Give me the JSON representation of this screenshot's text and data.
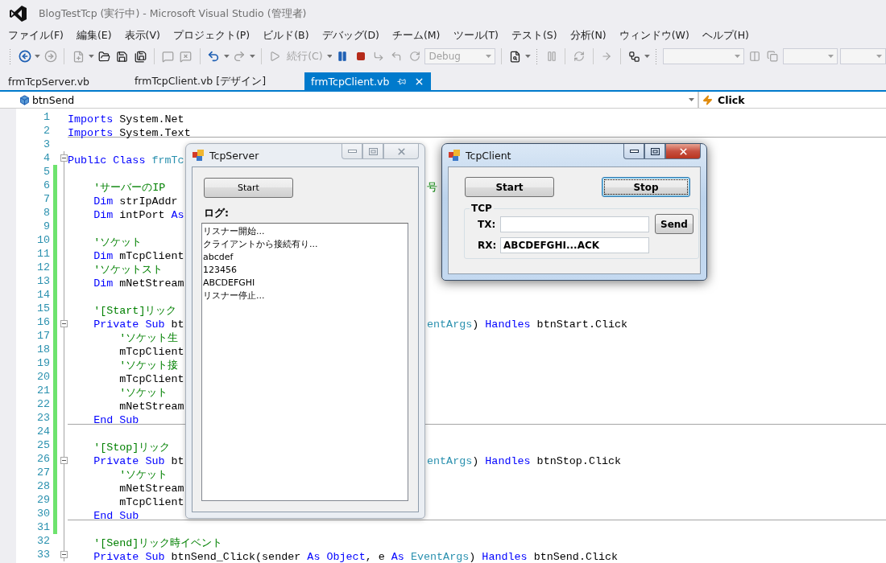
{
  "window": {
    "title": "BlogTestTcp (実行中) - Microsoft Visual Studio (管理者)"
  },
  "menu": [
    "ファイル(F)",
    "編集(E)",
    "表示(V)",
    "プロジェクト(P)",
    "ビルド(B)",
    "デバッグ(D)",
    "チーム(M)",
    "ツール(T)",
    "テスト(S)",
    "分析(N)",
    "ウィンドウ(W)",
    "ヘルプ(H)"
  ],
  "toolbar": {
    "continue_button": {
      "label": "続行(C)",
      "disabled": true
    },
    "configuration": {
      "value": "Debug",
      "disabled": true
    }
  },
  "tabs": [
    {
      "label": "frmTcpServer.vb",
      "selected": false
    },
    {
      "label": "frmTcpClient.vb [デザイン]",
      "selected": false
    },
    {
      "label": "frmTcpClient.vb",
      "selected": true
    }
  ],
  "navigation": {
    "object": "btnSend",
    "event": "Click"
  },
  "code_lines": [
    {
      "number": "1",
      "changed": false,
      "collapsible": false,
      "separator": false,
      "tokens": [
        {
          "kind": "keyword",
          "text": "Imports"
        },
        {
          "kind": "plain",
          "text": " System.Net"
        }
      ]
    },
    {
      "number": "2",
      "changed": false,
      "collapsible": false,
      "separator": true,
      "tokens": [
        {
          "kind": "keyword",
          "text": "Imports"
        },
        {
          "kind": "plain",
          "text": " System.Text"
        }
      ]
    },
    {
      "number": "3",
      "changed": false,
      "collapsible": false,
      "separator": false
    },
    {
      "number": "4",
      "changed": false,
      "collapsible": true,
      "separator": false,
      "tokens": [
        {
          "kind": "keyword",
          "text": "Public Class "
        },
        {
          "kind": "type",
          "text": "frmTc"
        }
      ]
    },
    {
      "number": "5",
      "changed": true,
      "collapsible": false,
      "separator": false
    },
    {
      "number": "6",
      "changed": true,
      "collapsible": false,
      "separator": false,
      "tokens": [
        {
          "kind": "comment",
          "text": "    'サーバーのIP"
        }
      ],
      "right": [
        {
          "kind": "comment",
          "text": "号"
        }
      ]
    },
    {
      "number": "7",
      "changed": true,
      "collapsible": false,
      "separator": false,
      "tokens": [
        {
          "kind": "keyword",
          "text": "    Dim"
        },
        {
          "kind": "plain",
          "text": " strIpAddr"
        }
      ]
    },
    {
      "number": "8",
      "changed": true,
      "collapsible": false,
      "separator": false,
      "tokens": [
        {
          "kind": "keyword",
          "text": "    Dim"
        },
        {
          "kind": "plain",
          "text": " intPort "
        },
        {
          "kind": "keyword",
          "text": "As"
        }
      ]
    },
    {
      "number": "9",
      "changed": true,
      "collapsible": false,
      "separator": false
    },
    {
      "number": "10",
      "changed": true,
      "collapsible": false,
      "separator": false,
      "tokens": [
        {
          "kind": "comment",
          "text": "    'ソケット"
        }
      ]
    },
    {
      "number": "11",
      "changed": true,
      "collapsible": false,
      "separator": false,
      "tokens": [
        {
          "kind": "keyword",
          "text": "    Dim"
        },
        {
          "kind": "plain",
          "text": " mTcpClient"
        }
      ]
    },
    {
      "number": "12",
      "changed": true,
      "collapsible": false,
      "separator": false,
      "tokens": [
        {
          "kind": "comment",
          "text": "    'ソケットスト"
        }
      ]
    },
    {
      "number": "13",
      "changed": true,
      "collapsible": false,
      "separator": false,
      "tokens": [
        {
          "kind": "keyword",
          "text": "    Dim"
        },
        {
          "kind": "plain",
          "text": " mNetStream"
        }
      ]
    },
    {
      "number": "14",
      "changed": true,
      "collapsible": false,
      "separator": false
    },
    {
      "number": "15",
      "changed": true,
      "collapsible": false,
      "separator": false,
      "tokens": [
        {
          "kind": "comment",
          "text": "    '[Start]リック"
        }
      ]
    },
    {
      "number": "16",
      "changed": true,
      "collapsible": true,
      "separator": false,
      "tokens": [
        {
          "kind": "keyword",
          "text": "    Private Sub"
        },
        {
          "kind": "plain",
          "text": " bt"
        }
      ],
      "right": [
        {
          "kind": "type",
          "text": "entArgs"
        },
        {
          "kind": "plain",
          "text": ") "
        },
        {
          "kind": "keyword",
          "text": "Handles"
        },
        {
          "kind": "plain",
          "text": " btnStart.Click"
        }
      ]
    },
    {
      "number": "17",
      "changed": true,
      "collapsible": false,
      "separator": false,
      "tokens": [
        {
          "kind": "comment",
          "text": "        'ソケット生"
        }
      ]
    },
    {
      "number": "18",
      "changed": true,
      "collapsible": false,
      "separator": false,
      "tokens": [
        {
          "kind": "plain",
          "text": "        mTcpClient"
        }
      ]
    },
    {
      "number": "19",
      "changed": true,
      "collapsible": false,
      "separator": false,
      "tokens": [
        {
          "kind": "comment",
          "text": "        'ソケット接"
        }
      ]
    },
    {
      "number": "20",
      "changed": true,
      "collapsible": false,
      "separator": false,
      "tokens": [
        {
          "kind": "plain",
          "text": "        mTcpClient"
        }
      ]
    },
    {
      "number": "21",
      "changed": true,
      "collapsible": false,
      "separator": false,
      "tokens": [
        {
          "kind": "comment",
          "text": "        'ソケット"
        }
      ]
    },
    {
      "number": "22",
      "changed": true,
      "collapsible": false,
      "separator": false,
      "tokens": [
        {
          "kind": "plain",
          "text": "        mNetStream"
        }
      ]
    },
    {
      "number": "23",
      "changed": true,
      "collapsible": false,
      "separator": true,
      "tokens": [
        {
          "kind": "keyword",
          "text": "    End Sub"
        }
      ]
    },
    {
      "number": "24",
      "changed": true,
      "collapsible": false,
      "separator": false
    },
    {
      "number": "25",
      "changed": true,
      "collapsible": false,
      "separator": false,
      "tokens": [
        {
          "kind": "comment",
          "text": "    '[Stop]リック"
        }
      ]
    },
    {
      "number": "26",
      "changed": true,
      "collapsible": true,
      "separator": false,
      "tokens": [
        {
          "kind": "keyword",
          "text": "    Private Sub"
        },
        {
          "kind": "plain",
          "text": " bt"
        }
      ],
      "right": [
        {
          "kind": "type",
          "text": "entArgs"
        },
        {
          "kind": "plain",
          "text": ") "
        },
        {
          "kind": "keyword",
          "text": "Handles"
        },
        {
          "kind": "plain",
          "text": " btnStop.Click"
        }
      ]
    },
    {
      "number": "27",
      "changed": true,
      "collapsible": false,
      "separator": false,
      "tokens": [
        {
          "kind": "comment",
          "text": "        'ソケット"
        }
      ]
    },
    {
      "number": "28",
      "changed": true,
      "collapsible": false,
      "separator": false,
      "tokens": [
        {
          "kind": "plain",
          "text": "        mNetStream"
        }
      ]
    },
    {
      "number": "29",
      "changed": true,
      "collapsible": false,
      "separator": false,
      "tokens": [
        {
          "kind": "plain",
          "text": "        mTcpClient"
        }
      ]
    },
    {
      "number": "30",
      "changed": true,
      "collapsible": false,
      "separator": true,
      "tokens": [
        {
          "kind": "keyword",
          "text": "    End Sub"
        }
      ]
    },
    {
      "number": "31",
      "changed": true,
      "collapsible": false,
      "separator": false
    },
    {
      "number": "32",
      "changed": false,
      "collapsible": false,
      "separator": false,
      "tokens": [
        {
          "kind": "comment",
          "text": "    '[Send]リック時イベント"
        }
      ]
    },
    {
      "number": "33",
      "changed": false,
      "collapsible": true,
      "separator": false,
      "tokens": [
        {
          "kind": "keyword",
          "text": "    Private Sub"
        },
        {
          "kind": "plain",
          "text": " btnSend_Click(sender "
        },
        {
          "kind": "keyword",
          "text": "As Object"
        },
        {
          "kind": "plain",
          "text": ", e "
        },
        {
          "kind": "keyword",
          "text": "As "
        },
        {
          "kind": "type",
          "text": "EventArgs"
        },
        {
          "kind": "plain",
          "text": ") "
        },
        {
          "kind": "keyword",
          "text": "Handles"
        },
        {
          "kind": "plain",
          "text": " btnSend.Click"
        }
      ]
    }
  ],
  "server_window": {
    "title": "TcpServer",
    "active": false,
    "start_button": "Start",
    "log_label": "ログ:",
    "log": [
      "リスナー開始...",
      "クライアントから接続有り...",
      "abcdef",
      "123456",
      "ABCDEFGHI",
      "リスナー停止..."
    ]
  },
  "client_window": {
    "title": "TcpClient",
    "active": true,
    "start_button": "Start",
    "stop_button": {
      "label": "Stop",
      "focused": true
    },
    "group": "TCP",
    "tx": {
      "label": "TX:"
    },
    "send_button": "Send",
    "rx": {
      "label": "RX:",
      "value": "ABCDEFGHI...ACK"
    }
  }
}
